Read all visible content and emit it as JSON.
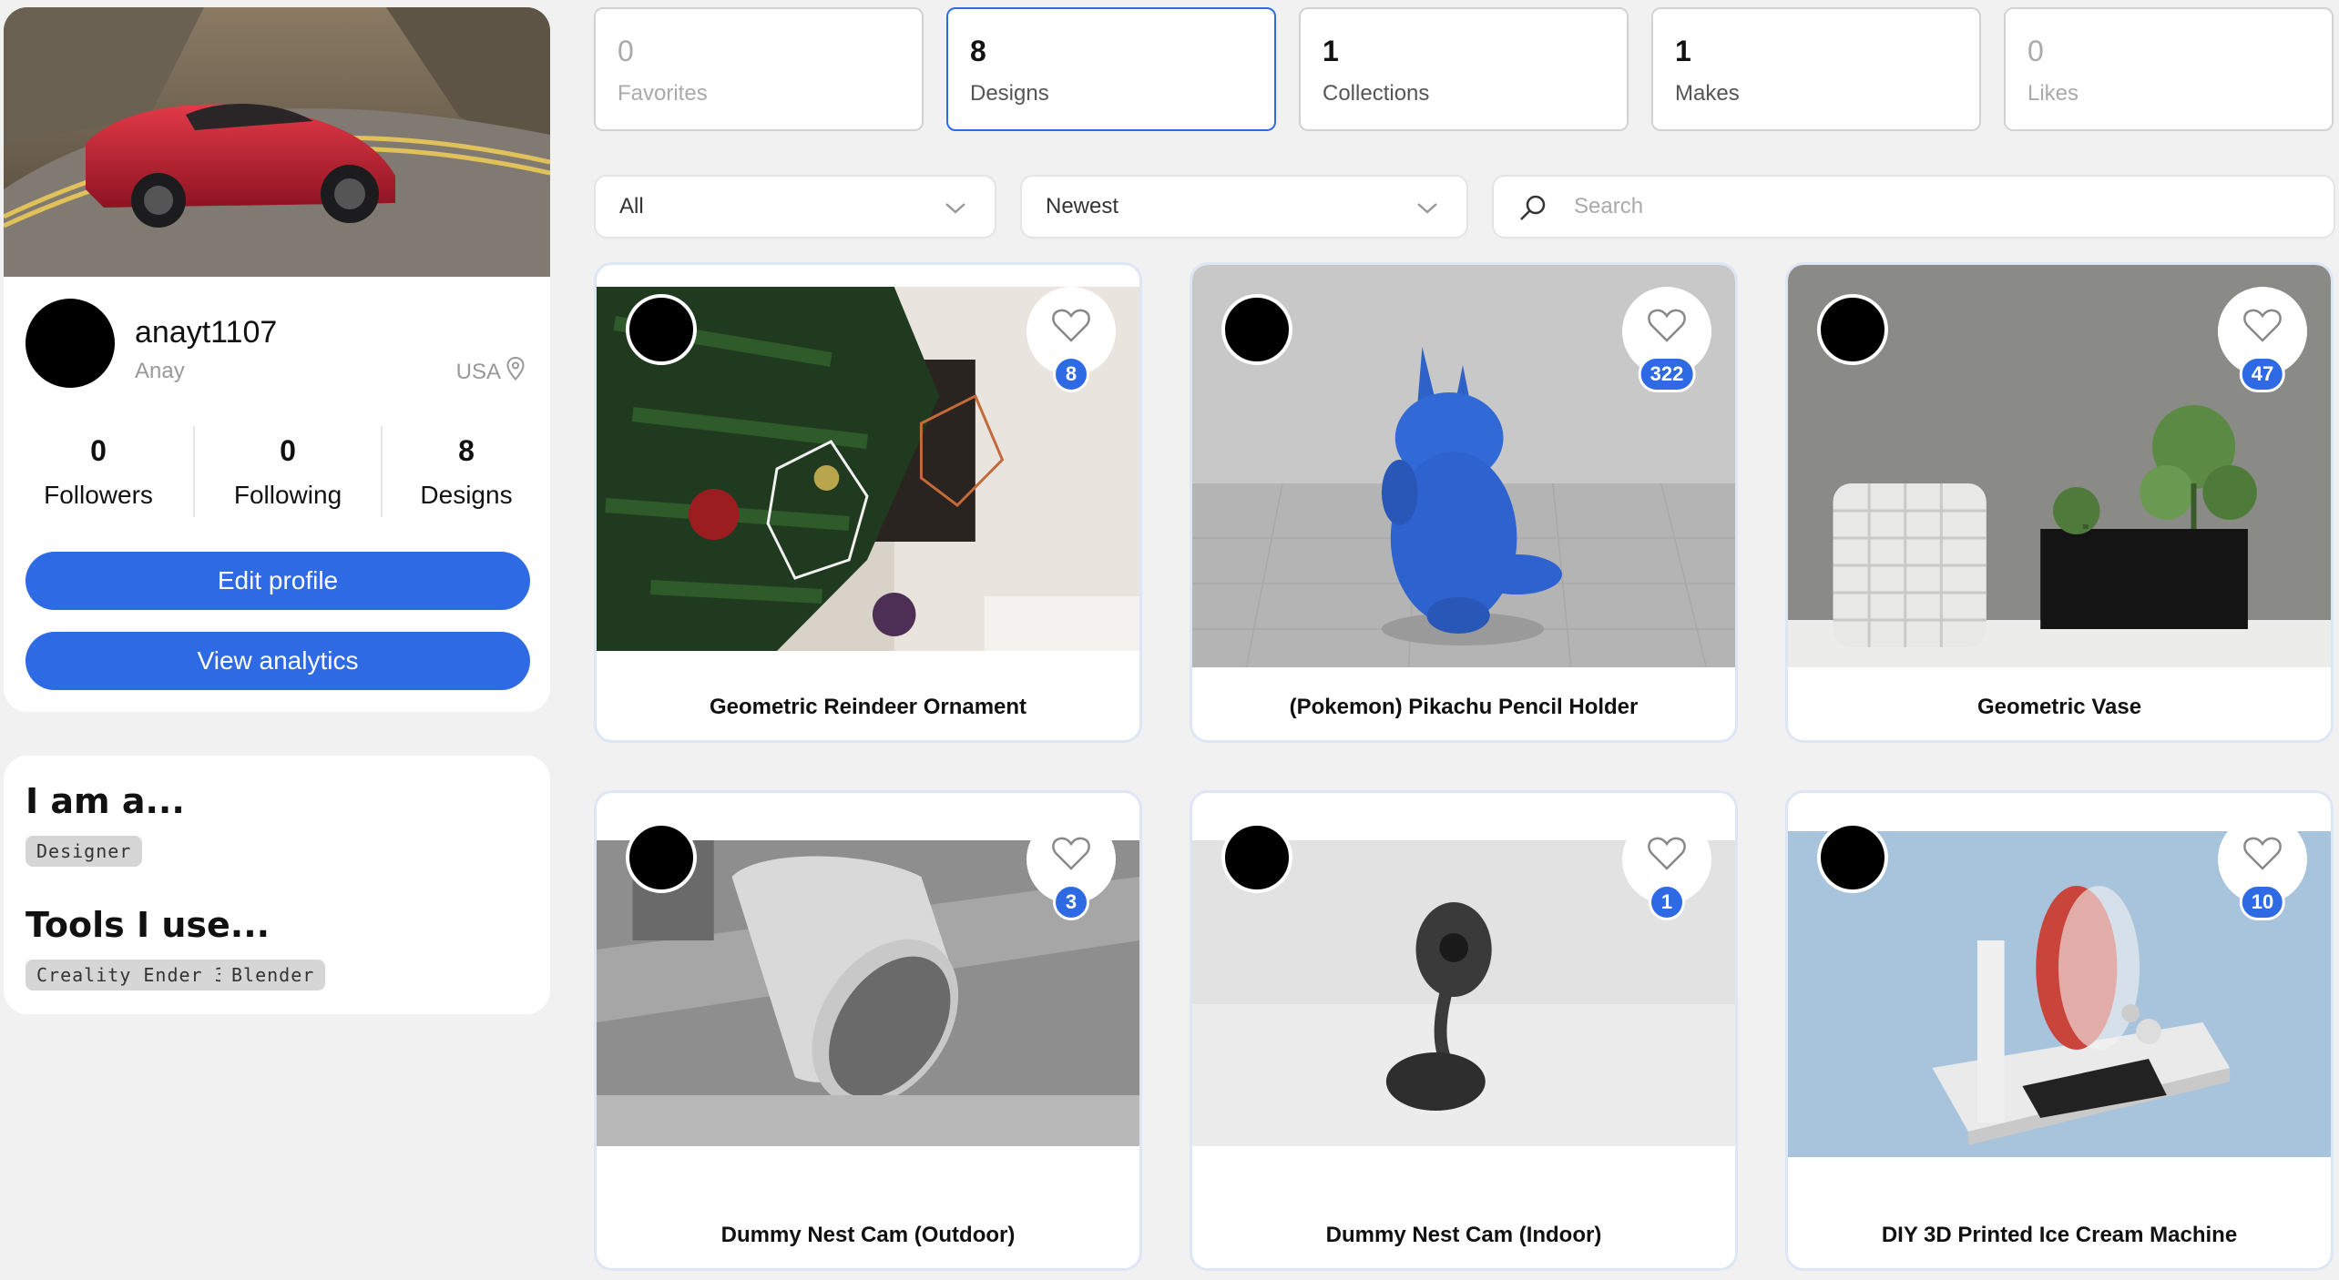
{
  "profile": {
    "username": "anayt1107",
    "real_name": "Anay",
    "location": "USA",
    "stats": [
      {
        "value": "0",
        "label": "Followers"
      },
      {
        "value": "0",
        "label": "Following"
      },
      {
        "value": "8",
        "label": "Designs"
      }
    ],
    "edit_label": "Edit profile",
    "analytics_label": "View analytics"
  },
  "about": {
    "role_heading": "I am a...",
    "roles": [
      "Designer"
    ],
    "tools_heading": "Tools I use...",
    "tools": [
      "Creality Ender 3",
      "Blender"
    ]
  },
  "tabs": [
    {
      "count": "0",
      "label": "Favorites",
      "active": false
    },
    {
      "count": "8",
      "label": "Designs",
      "active": true
    },
    {
      "count": "1",
      "label": "Collections",
      "active": false
    },
    {
      "count": "1",
      "label": "Makes",
      "active": false
    },
    {
      "count": "0",
      "label": "Likes",
      "active": false
    }
  ],
  "filters": {
    "category": "All",
    "sort": "Newest",
    "search_placeholder": "Search"
  },
  "designs": [
    {
      "title": "Geometric Reindeer Ornament",
      "likes": "8"
    },
    {
      "title": "(Pokemon) Pikachu Pencil Holder",
      "likes": "322"
    },
    {
      "title": "Geometric Vase",
      "likes": "47"
    },
    {
      "title": "Dummy Nest Cam (Outdoor)",
      "likes": "3"
    },
    {
      "title": "Dummy Nest Cam (Indoor)",
      "likes": "1"
    },
    {
      "title": "DIY 3D Printed Ice Cream Machine",
      "likes": "10"
    }
  ],
  "colors": {
    "accent": "#2f6ae5",
    "background": "#f1f1f1"
  },
  "icons": {
    "location": "map-pin-icon",
    "heart": "heart-outline-icon",
    "search": "search-icon",
    "dropdown": "chevron-down-icon"
  }
}
